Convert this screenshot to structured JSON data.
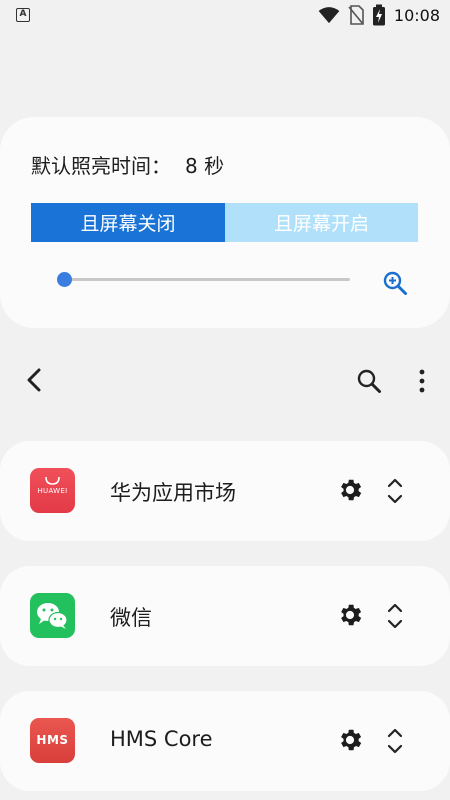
{
  "status_bar": {
    "time": "10:08",
    "left_icon": "A"
  },
  "timeout": {
    "label": "默认照亮时间：",
    "value": "8 秒"
  },
  "segments": {
    "screen_off": "且屏幕关闭",
    "screen_on": "且屏幕开启"
  },
  "slider": {
    "level": 0.0
  },
  "icons": {
    "zoom": "zoom-in-icon",
    "back": "chevron-left-icon",
    "search": "search-icon",
    "more": "more-vert-icon",
    "gear": "gear-icon",
    "expand": "unfold-icon"
  },
  "colors": {
    "accent": "#1a73d6",
    "accent_light": "#b1e1fa",
    "huawei_red": "#e8414e",
    "wechat_green": "#22c15e",
    "hms_red": "#e04a45"
  },
  "apps": [
    {
      "name": "华为应用市场",
      "icon_text": "HUAWEI"
    },
    {
      "name": "微信",
      "icon_text": ""
    },
    {
      "name": "HMS Core",
      "icon_text": "HMS"
    }
  ]
}
